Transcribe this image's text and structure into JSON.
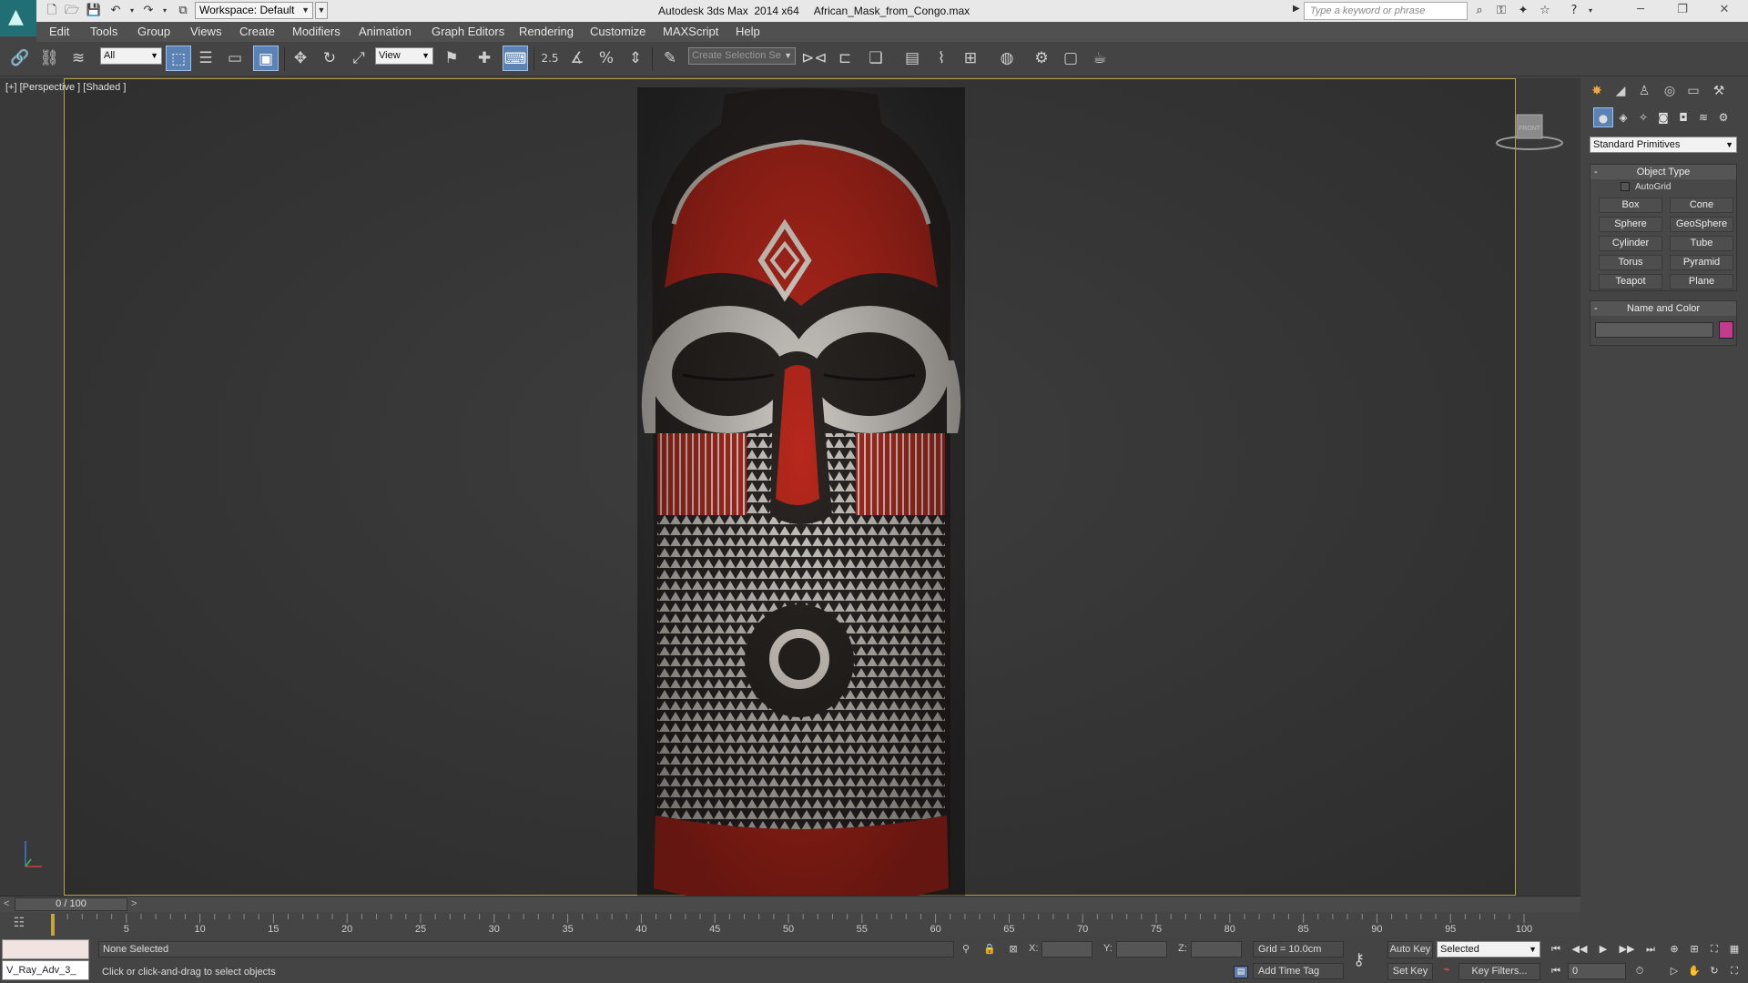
{
  "window": {
    "title": "Autodesk 3ds Max  2014 x64     African_Mask_from_Congo.max",
    "workspace": "Workspace: Default",
    "search_placeholder": "Type a keyword or phrase"
  },
  "menu": [
    "Edit",
    "Tools",
    "Group",
    "Views",
    "Create",
    "Modifiers",
    "Animation",
    "Graph Editors",
    "Rendering",
    "Customize",
    "MAXScript",
    "Help"
  ],
  "toolbar": {
    "selection_filter": "All",
    "ref_coord": "View",
    "snap_value": "2.5",
    "selection_set_placeholder": "Create Selection Se"
  },
  "viewport": {
    "label": "[+] [Perspective ] [Shaded ]",
    "viewcube_face": "FRONT"
  },
  "command_panel": {
    "primitive_type": "Standard Primitives",
    "object_type_title": "Object Type",
    "autogrid_label": "AutoGrid",
    "primitives": [
      "Box",
      "Cone",
      "Sphere",
      "GeoSphere",
      "Cylinder",
      "Tube",
      "Torus",
      "Pyramid",
      "Teapot",
      "Plane"
    ],
    "name_color_title": "Name and Color",
    "object_color": "#c43a8d"
  },
  "timeline": {
    "frame_display": "0 / 100",
    "ticks": [
      5,
      10,
      15,
      20,
      25,
      30,
      35,
      40,
      45,
      50,
      55,
      60,
      65,
      70,
      75,
      80,
      85,
      90,
      95,
      100
    ]
  },
  "status": {
    "maxscript_listener": "V_Ray_Adv_3_",
    "selection": "None Selected",
    "prompt": "Click or click-and-drag to select objects",
    "x_label": "X:",
    "y_label": "Y:",
    "z_label": "Z:",
    "grid": "Grid = 10.0cm",
    "add_time_tag": "Add Time Tag",
    "auto_key": "Auto Key",
    "set_key": "Set Key",
    "key_mode": "Selected",
    "key_filters": "Key Filters...",
    "current_frame": "0"
  }
}
